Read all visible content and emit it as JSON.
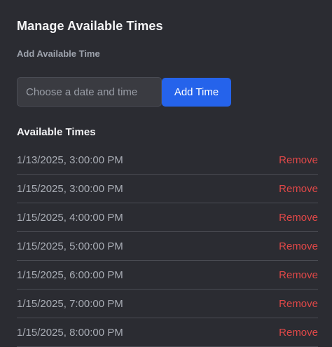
{
  "header": {
    "title": "Manage Available Times",
    "add_subtitle": "Add Available Time"
  },
  "form": {
    "date_input_placeholder": "Choose a date and time",
    "date_input_value": "",
    "add_button_label": "Add Time"
  },
  "list": {
    "title": "Available Times",
    "remove_label": "Remove",
    "items": [
      "1/13/2025, 3:00:00 PM",
      "1/15/2025, 3:00:00 PM",
      "1/15/2025, 4:00:00 PM",
      "1/15/2025, 5:00:00 PM",
      "1/15/2025, 6:00:00 PM",
      "1/15/2025, 7:00:00 PM",
      "1/15/2025, 8:00:00 PM"
    ]
  },
  "colors": {
    "background": "#2b2c32",
    "accent": "#2563eb",
    "remove": "#e04848"
  }
}
